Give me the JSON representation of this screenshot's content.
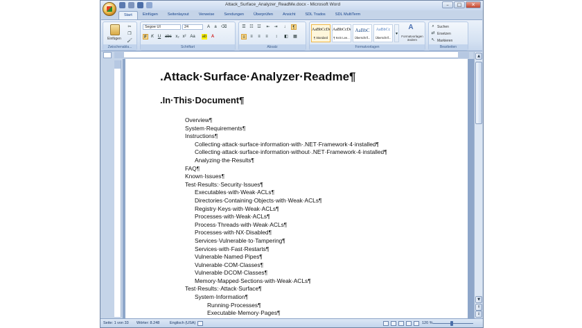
{
  "window": {
    "title": "Attack_Surface_Analyzer_ReadMe.docx - Microsoft Word",
    "controls": [
      "–",
      "□",
      "✕"
    ]
  },
  "tabs": [
    "Start",
    "Einfügen",
    "Seitenlayout",
    "Verweise",
    "Sendungen",
    "Überprüfen",
    "Ansicht",
    "SDL Trados",
    "SDL MultiTerm"
  ],
  "ribbon": {
    "clipboard": {
      "paste_label": "Einfügen",
      "group_label": "Zwischenabla..."
    },
    "font": {
      "font_name": "Segoe UI",
      "font_size": "24",
      "group_label": "Schriftart"
    },
    "paragraph": {
      "group_label": "Absatz"
    },
    "styles": {
      "tiles": [
        {
          "sample": "AaBbCcDc",
          "name": "¶ Standard"
        },
        {
          "sample": "AaBbCcDc",
          "name": "¶ Kein Lee..."
        },
        {
          "sample": "AaBbC",
          "name": "Überschrif..."
        },
        {
          "sample": "AaBbCc",
          "name": "Überschrif..."
        }
      ],
      "change_styles": "Formatvorlagen ändern",
      "group_label": "Formatvorlagen"
    },
    "editing": {
      "find": "Suchen",
      "replace": "Ersetzen",
      "select": "Markieren",
      "group_label": "Bearbeiten"
    }
  },
  "document": {
    "title": ".Attack·Surface·Analyzer·Readme¶",
    "heading": ".In·This·Document¶",
    "toc": [
      {
        "text": "Overview¶",
        "level": 1
      },
      {
        "text": "System·Requirements¶",
        "level": 1
      },
      {
        "text": "Instructions¶",
        "level": 1
      },
      {
        "text": "Collecting·attack·surface·information·with·.NET·Framework·4·installed¶",
        "level": 2
      },
      {
        "text": "Collecting·attack·surface·information·without·.NET·Framework·4·installed¶",
        "level": 2
      },
      {
        "text": "Analyzing·the·Results¶",
        "level": 2
      },
      {
        "text": "FAQ¶",
        "level": 1
      },
      {
        "text": "Known·Issues¶",
        "level": 1
      },
      {
        "text": "Test·Results:·Security·Issues¶",
        "level": 1
      },
      {
        "text": "Executables·with·Weak·ACLs¶",
        "level": 2
      },
      {
        "text": "Directories·Containing·Objects·with·Weak·ACLs¶",
        "level": 2
      },
      {
        "text": "Registry·Keys·with·Weak·ACLs¶",
        "level": 2
      },
      {
        "text": "Processes·with·Weak·ACLs¶",
        "level": 2
      },
      {
        "text": "Process·Threads·with·Weak·ACLs¶",
        "level": 2
      },
      {
        "text": "Processes·with·NX·Disabled¶",
        "level": 2
      },
      {
        "text": "Services·Vulnerable·to·Tampering¶",
        "level": 2
      },
      {
        "text": "Services·with·Fast·Restarts¶",
        "level": 2
      },
      {
        "text": "Vulnerable·Named·Pipes¶",
        "level": 2
      },
      {
        "text": "Vulnerable·COM·Classes¶",
        "level": 2
      },
      {
        "text": "Vulnerable·DCOM·Classes¶",
        "level": 2
      },
      {
        "text": "Memory·Mapped·Sections·with·Weak·ACLs¶",
        "level": 2
      },
      {
        "text": "Test·Results:·Attack·Surface¶",
        "level": 1
      },
      {
        "text": "System·Information¶",
        "level": 2
      },
      {
        "text": "Running·Processes¶",
        "level": 3
      },
      {
        "text": "Executable·Memory·Pages¶",
        "level": 3
      }
    ]
  },
  "status": {
    "page": "Seite: 1 von 33",
    "words": "Wörter: 8.248",
    "language": "Englisch (USA)",
    "zoom": "120 %"
  }
}
